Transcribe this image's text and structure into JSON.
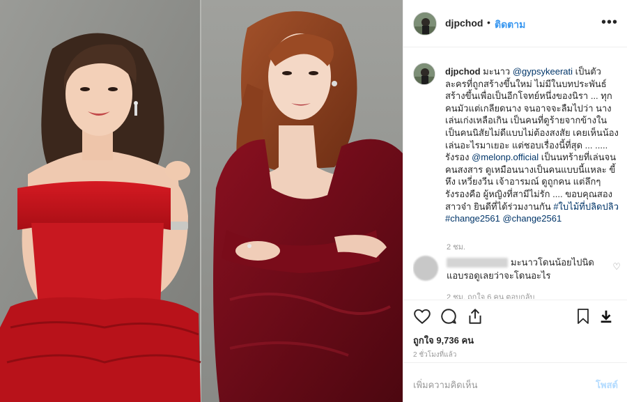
{
  "post": {
    "username": "djpchod",
    "separator": "•",
    "follow_label": "ติดตาม",
    "more_label": "•••"
  },
  "caption": {
    "username": "djpchod",
    "part1": "มะนาว",
    "mention1": "@gypsykeerati",
    "part2": "เป็นตัวละครที่ถูกสร้างขึ้นใหม่ ไม่มีในบทประพันธ์ สร้างขึ้นเพื่อเป็นอีกโจทย์หนึ่งของนิรา ... ทุกคนมัวแต่เกลียดนาง จนอาจจะลืมไปว่า นางเล่นเก่งเหลือเกิน เป็นคนที่ดูร้ายจากข้างในเป็นคนนิสัยไม่ดีแบบไม่ต้องสงสัย เคยเห็นน้องเล่นอะไรมาเยอะ แต่ชอบเรื่องนี้ที่สุด ... ..... รังรอง",
    "mention2": "@melonp.official",
    "part3": "เป็นนทร้ายที่เล่นจนคนสงสาร ดูเหมือนนางเป็นคนแบบนี้แหละ ขี้หึง เหวี่ยงวีน เจ้าอารมณ์ ดูถูกคน แต่ลึกๆรังรองคือ ผู้หญิงที่สามีไม่รัก .... ขอบคุณสองสาวจ๋า ยินดีที่ได้ร่วมงานกัน",
    "hashtag1": "#ใบไม้ที่ปลิดปลิว",
    "hashtag2": "#change2561",
    "mention3": "@change2561",
    "time": "2 ชม."
  },
  "comment": {
    "text": "มะนาวโดนน้อยไปนิด แอบรอดูเลยว่าจะโดนอะไร",
    "meta": "2 ชม.   ถูกใจ 6 คน   ตอบกลับ"
  },
  "likes_label": "ถูกใจ 9,736 คน",
  "time_ago": "2 ชั่วโมงที่แล้ว",
  "add_comment": {
    "placeholder": "เพิ่มความคิดเห็น",
    "post_label": "โพสต์"
  },
  "icons": [
    "heart-icon",
    "comment-icon",
    "share-icon",
    "bookmark-icon",
    "download-icon"
  ],
  "colors": {
    "accent": "#3897f0",
    "link": "#003569",
    "dress_red": "#c0141b",
    "velvet_red": "#6e0b14"
  }
}
